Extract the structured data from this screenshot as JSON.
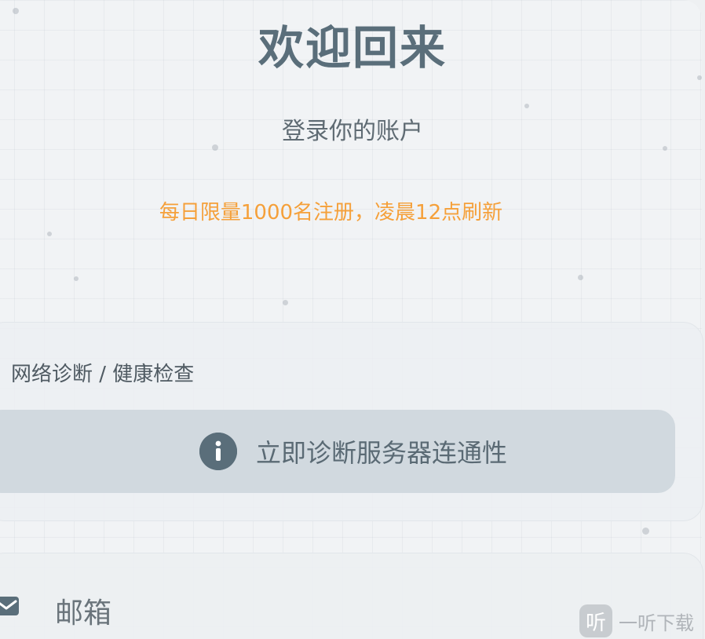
{
  "header": {
    "title": "欢迎回来",
    "subtitle": "登录你的账户",
    "notice": "每日限量1000名注册，凌晨12点刷新"
  },
  "diagnostics": {
    "label": "网络诊断 / 健康检查",
    "button_label": "立即诊断服务器连通性",
    "icon": "info-icon"
  },
  "email": {
    "label": "邮箱",
    "icon": "mail-icon"
  },
  "watermark": {
    "logo_char": "听",
    "text": "一听下载"
  },
  "colors": {
    "title": "#5a6e7a",
    "notice": "#f5a03a",
    "button_bg": "#d1d9df",
    "icon": "#5a6e7a"
  }
}
